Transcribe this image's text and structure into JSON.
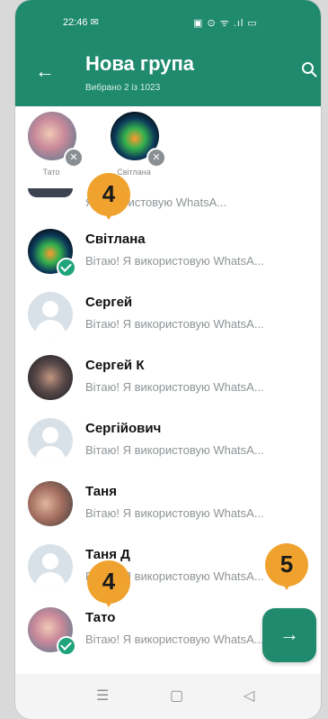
{
  "status_bar": {
    "time": "22:46 ✉",
    "icons": "▣ ⊙ ᯤ .ıl ▭"
  },
  "header": {
    "back": "←",
    "title": "Нова група",
    "subtitle": "Вибрано 2 із 1023"
  },
  "selected": [
    {
      "name": "Тато"
    },
    {
      "name": "Світлана"
    }
  ],
  "contacts": [
    {
      "name": "",
      "status": "Я використовую WhatsA..."
    },
    {
      "name": "Світлана",
      "status": "Вітаю! Я використовую WhatsA..."
    },
    {
      "name": "Сергей",
      "status": "Вітаю! Я використовую WhatsA..."
    },
    {
      "name": "Сергей К",
      "status": "Вітаю! Я використовую WhatsA..."
    },
    {
      "name": "Сергійович",
      "status": "Вітаю! Я використовую WhatsA..."
    },
    {
      "name": "Таня",
      "status": "Вітаю! Я використовую WhatsA..."
    },
    {
      "name": "Таня Д",
      "status": "Вітаю! Я використовую WhatsA..."
    },
    {
      "name": "Тато",
      "status": "Вітаю! Я використовую WhatsA..."
    }
  ],
  "annotations": {
    "step_a": "4",
    "step_b": "4",
    "step_c": "5"
  },
  "fab": {
    "arrow": "→"
  },
  "navbar": {
    "recent": "☰",
    "home": "▢",
    "back": "◁"
  },
  "colors": {
    "accent": "#1f8a6d",
    "check": "#1fa37a",
    "annotation": "#f0a22e"
  }
}
